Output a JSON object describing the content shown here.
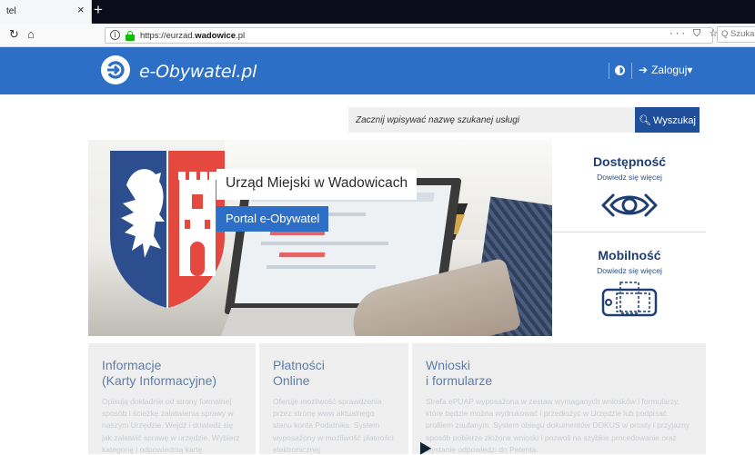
{
  "browser": {
    "tab_title": "tel",
    "tab_close": "×",
    "new_tab": "+",
    "reload_icon": "reload-icon",
    "home_icon": "home-icon",
    "url_prefix": "https://eurzad.",
    "url_domain": "wadowice",
    "url_suffix": ".pl",
    "url_actions": "··· ⛉ ☆",
    "search_placeholder": "Q Szuka"
  },
  "header": {
    "logo_text": "e-Obywatel.pl",
    "login_label": "Zaloguj",
    "login_caret": "▾",
    "login_arrow": "➔"
  },
  "search": {
    "placeholder": "Zacznij wpisywać nazwę szukanej usługi",
    "button_label": "Wyszukaj",
    "button_icon": "search-icon"
  },
  "hero": {
    "title": "Urząd Miejski w Wadowicach",
    "subtitle": "Portal e-Obywatel"
  },
  "side": {
    "accessibility_title": "Dostępność",
    "accessibility_link": "Dowiedz się więcej",
    "mobility_title": "Mobilność",
    "mobility_link": "Dowiedz się więcej"
  },
  "cards": [
    {
      "title_line1": "Informacje",
      "title_line2": "(Karty Informacyjne)",
      "desc": "Opisują dokładnie od strony formalnej sposób i ścieżkę załatwienia sprawy w naszym Urzędzie. Wejdź i dowiedz się jak załatwić sprawę w urzędzie. Wybierz kategorię i odpowiednią kartę"
    },
    {
      "title_line1": "Płatności",
      "title_line2": "Online",
      "desc": "Oferuje możliwość sprawdzenia przez stronę www aktualnego stanu konta Podatnika. System wyposażony w możliwość płatności elektronicznej"
    },
    {
      "title_line1": "Wnioski",
      "title_line2": "i formularze",
      "desc": "Strefa ePUAP wyposażona w zestaw wymaganych wniosków i formularzy, które będzie można wydrukować i przedłożyć w Urzędzie lub podpisać profilem zaufanym. System obiegu dokumentów DOKUS w prosty i przyjazny sposób pobierze złożone wnioski i pozwoli na szybkie procedowanie oraz wystanie odpowiedzi do Petenta."
    }
  ],
  "colors": {
    "brand_blue": "#2d6fc6",
    "button_blue": "#1f4f9a",
    "heading_navy": "#1e3e73",
    "crest_red": "#e5483f",
    "crest_blue": "#2c4d8e"
  }
}
